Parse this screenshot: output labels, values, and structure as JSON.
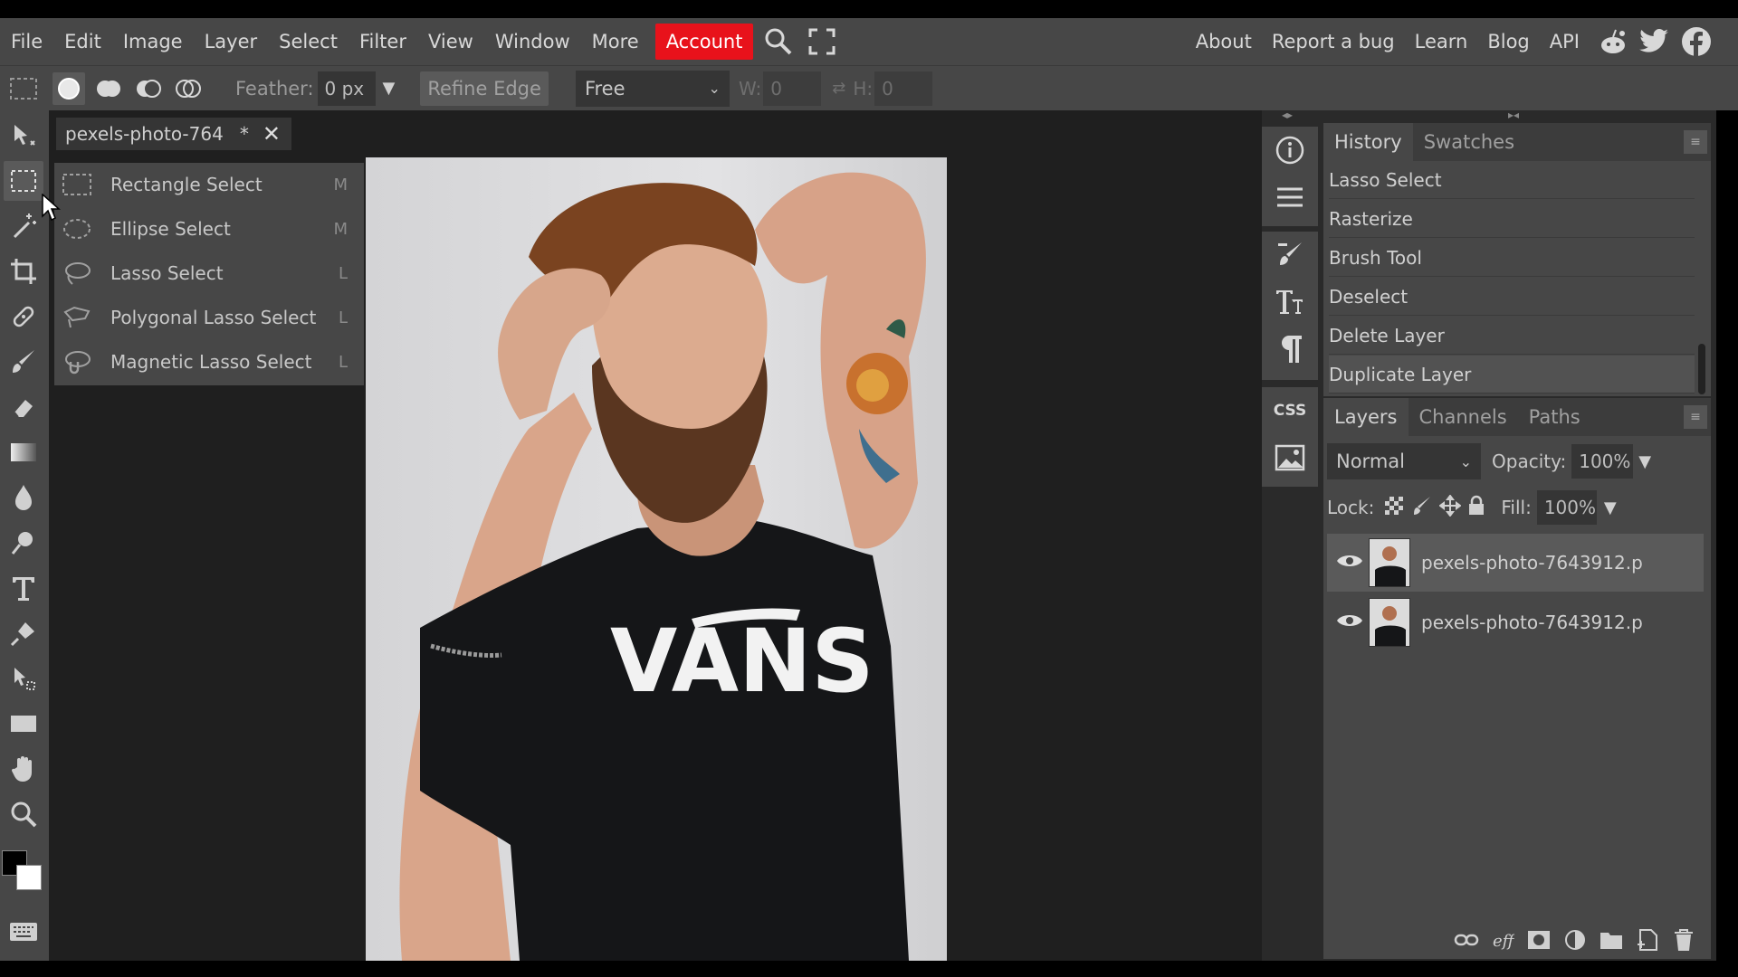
{
  "menubar": {
    "items": [
      "File",
      "Edit",
      "Image",
      "Layer",
      "Select",
      "Filter",
      "View",
      "Window",
      "More"
    ],
    "account_label": "Account",
    "right_items": [
      "About",
      "Report a bug",
      "Learn",
      "Blog",
      "API"
    ]
  },
  "options": {
    "feather_label": "Feather:",
    "feather_value": "0 px",
    "refine_edge_label": "Refine Edge",
    "style_value": "Free",
    "w_label": "W:",
    "w_value": "0",
    "h_label": "H:",
    "h_value": "0"
  },
  "document": {
    "tab_title": "pexels-photo-764",
    "tab_modified": "*",
    "close_label": "✕"
  },
  "flyout": {
    "items": [
      {
        "label": "Rectangle Select",
        "key": "M"
      },
      {
        "label": "Ellipse Select",
        "key": "M"
      },
      {
        "label": "Lasso Select",
        "key": "L"
      },
      {
        "label": "Polygonal Lasso Select",
        "key": "L"
      },
      {
        "label": "Magnetic Lasso Select",
        "key": "L"
      }
    ]
  },
  "canvas": {
    "shirt_text": "VANS"
  },
  "rightcol": {
    "css_label": "CSS"
  },
  "history_panel": {
    "tabs": [
      "History",
      "Swatches"
    ],
    "items": [
      "Lasso Select",
      "Rasterize",
      "Brush Tool",
      "Deselect",
      "Delete Layer",
      "Duplicate Layer"
    ]
  },
  "layers_panel": {
    "tabs": [
      "Layers",
      "Channels",
      "Paths"
    ],
    "blend_mode": "Normal",
    "opacity_label": "Opacity:",
    "opacity_value": "100%",
    "lock_label": "Lock:",
    "fill_label": "Fill:",
    "fill_value": "100%",
    "layers": [
      {
        "name": "pexels-photo-7643912.p"
      },
      {
        "name": "pexels-photo-7643912.p"
      }
    ]
  },
  "colors": {
    "account_red": "#e8121b",
    "panel_gray": "#474747",
    "workspace_dark": "#1f1f1f"
  }
}
